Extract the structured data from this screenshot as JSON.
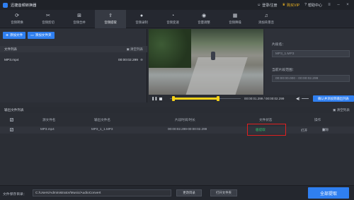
{
  "app": {
    "title": "迅捷音频转换器"
  },
  "titlebar": {
    "login": "登录/注册",
    "vip": "购买VIP",
    "help": "帮助中心"
  },
  "toolbar": {
    "tabs": [
      {
        "label": "音频转换",
        "icon": "refresh-icon"
      },
      {
        "label": "音频剪切",
        "icon": "scissors-icon"
      },
      {
        "label": "音频合并",
        "icon": "merge-icon"
      },
      {
        "label": "音频提取",
        "icon": "extract-icon",
        "active": true
      },
      {
        "label": "音频录制",
        "icon": "mic-icon"
      },
      {
        "label": "音频变速",
        "icon": "speed-icon"
      },
      {
        "label": "音量调整",
        "icon": "volume-icon"
      },
      {
        "label": "音频降噪",
        "icon": "noise-icon"
      },
      {
        "label": "添加背景音",
        "icon": "music-icon"
      }
    ]
  },
  "left": {
    "add_file": "添加文件",
    "add_folder": "添加文件夹",
    "list_title": "文件列表",
    "clear_list": "清空列表",
    "files": [
      {
        "name": "MP3.mp4",
        "duration": "00:00:02.299"
      }
    ]
  },
  "player": {
    "current": "00:00:01.299",
    "total": "00:00:02.299",
    "confirm": "确认并添加到输出列表"
  },
  "right": {
    "segment_label": "片段名：",
    "segment_value": "MP3_1.MP3",
    "range_label": "当前片段范围：",
    "range_value": "00:00:00.000 - 00:00:02.299"
  },
  "output": {
    "title": "输出文件列表",
    "clear": "清空列表",
    "columns": [
      "源文件名",
      "输出文件名",
      "片段时间/时长",
      "文件状态",
      "操作"
    ],
    "rows": [
      {
        "src": "MP3.mp4",
        "out": "MP3_1_1.MP3",
        "time": "00:00:02.299-00:00:02.299",
        "status": "已提取",
        "open": "打开",
        "delete": "删除"
      }
    ]
  },
  "bottom": {
    "save_label": "文件保存目录：",
    "save_path": "C:/Users/Administrator/Music/AudioConvert",
    "change_dir": "更改目录",
    "open_folder": "打开文件夹",
    "extract_all": "全部提取"
  },
  "colors": {
    "accent": "#2f7ff0",
    "selection": "#f5d11a",
    "status_ok": "#30c06a",
    "highlight": "#e02020"
  }
}
